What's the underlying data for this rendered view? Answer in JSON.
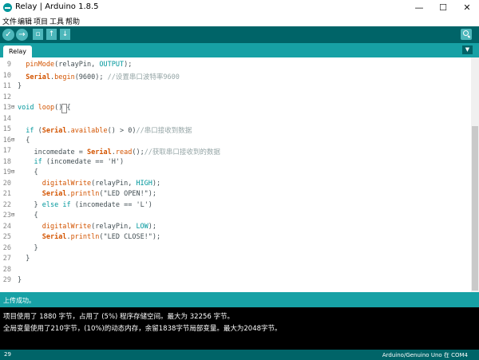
{
  "window": {
    "title": "Relay | Arduino 1.8.5",
    "minimize": "—",
    "maximize": "☐",
    "close": "✕"
  },
  "menu": [
    "文件",
    "编辑",
    "项目",
    "工具",
    "帮助"
  ],
  "toolbar": {
    "verify_icon": "✓",
    "upload_icon": "→",
    "new_icon": "▫",
    "open_icon": "↑",
    "save_icon": "↓",
    "icons": [
      "check-icon",
      "arrow-right-icon",
      "new-file-icon",
      "open-icon",
      "save-icon",
      "search-icon"
    ]
  },
  "tabs": {
    "active": "Relay",
    "menu_icon": "▼"
  },
  "editor": {
    "lines": [
      {
        "num": "9",
        "fold": "",
        "text": "  pinMode(relayPin, OUTPUT);"
      },
      {
        "num": "10",
        "fold": "",
        "text": "  Serial.begin(9600); //设置串口波特率9600"
      },
      {
        "num": "11",
        "fold": "",
        "text": "}"
      },
      {
        "num": "12",
        "fold": "",
        "text": ""
      },
      {
        "num": "13",
        "fold": "⊟",
        "text": "void loop() {"
      },
      {
        "num": "14",
        "fold": "",
        "text": ""
      },
      {
        "num": "15",
        "fold": "",
        "text": "  if (Serial.available() > 0)//串口接收到数据"
      },
      {
        "num": "16",
        "fold": "⊟",
        "text": "  {"
      },
      {
        "num": "17",
        "fold": "",
        "text": "    incomedate = Serial.read();//获取串口接收到的数据"
      },
      {
        "num": "18",
        "fold": "",
        "text": "    if (incomedate == 'H')"
      },
      {
        "num": "19",
        "fold": "⊟",
        "text": "    {"
      },
      {
        "num": "20",
        "fold": "",
        "text": "      digitalWrite(relayPin, HIGH);"
      },
      {
        "num": "21",
        "fold": "",
        "text": "      Serial.println(\"LED OPEN!\");"
      },
      {
        "num": "22",
        "fold": "",
        "text": "    } else if (incomedate == 'L')"
      },
      {
        "num": "23",
        "fold": "⊟",
        "text": "    {"
      },
      {
        "num": "24",
        "fold": "",
        "text": "      digitalWrite(relayPin, LOW);"
      },
      {
        "num": "25",
        "fold": "",
        "text": "      Serial.println(\"LED CLOSE!\");"
      },
      {
        "num": "26",
        "fold": "",
        "text": "    }"
      },
      {
        "num": "27",
        "fold": "",
        "text": "  }"
      },
      {
        "num": "28",
        "fold": "",
        "text": ""
      },
      {
        "num": "29",
        "fold": "",
        "text": "}"
      }
    ]
  },
  "status": "上传成功。",
  "console": [
    "项目使用了 1880 字节，占用了 (5%) 程序存储空间。最大为 32256 字节。",
    "全局变量使用了210字节，(10%)的动态内存，余留1838字节局部变量。最大为2048字节。"
  ],
  "footer": {
    "line": "29",
    "board": "Arduino/Genuino Uno 在 COM4"
  },
  "colors": {
    "toolbar": "#006468",
    "tab_bar": "#17a1a5",
    "accent": "#4db7bb",
    "console_bg": "#000000"
  }
}
